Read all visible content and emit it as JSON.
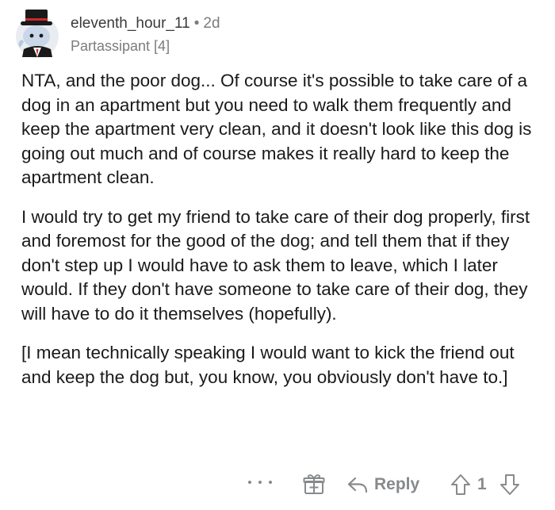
{
  "comment": {
    "author": "eleventh_hour_11",
    "separator": "•",
    "age": "2d",
    "flair": "Partassipant [4]",
    "paragraphs": [
      "NTA, and the poor dog... Of course it's possible to take care of a dog in an apartment but you need to walk them frequently and keep the apartment very clean, and it doesn't look like this dog is going out much and of course makes it really hard to keep the apartment clean.",
      "I would try to get my friend to take care of their dog properly, first and foremost for the good of the dog; and tell them that if they don't step up I would have to ask them to leave, which I later would. If they don't have someone to take care of their dog, they will have to do it themselves (hopefully).",
      "[I mean technically speaking I would want to kick the friend out and keep the dog but, you know, you obviously don't have to.]"
    ]
  },
  "actions": {
    "more_icon": "more-options-icon",
    "award_icon": "award-gift-icon",
    "reply_icon": "reply-arrow-icon",
    "reply_label": "Reply",
    "upvote_icon": "upvote-arrow-icon",
    "score": "1",
    "downvote_icon": "downvote-arrow-icon",
    "icon_color": "#878a8c"
  }
}
